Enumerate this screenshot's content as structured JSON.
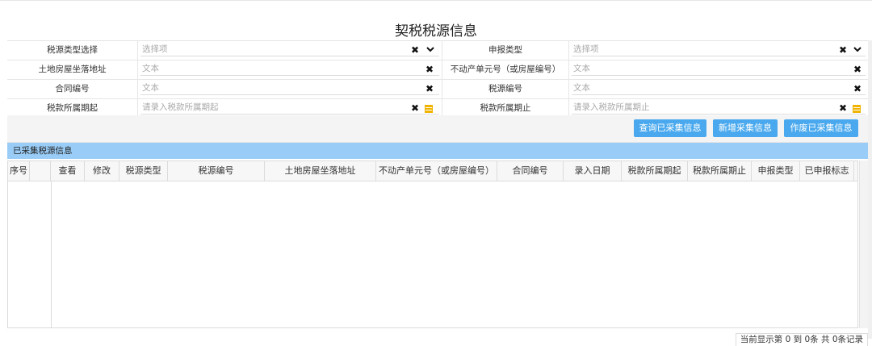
{
  "page": {
    "title": "契税税源信息"
  },
  "form": {
    "tax_type_label": "税源类型选择",
    "tax_type_placeholder": "选择项",
    "declare_type_label": "申报类型",
    "declare_type_placeholder": "选择项",
    "address_label": "土地房屋坐落地址",
    "address_placeholder": "文本",
    "property_unit_label": "不动产单元号（或房屋编号）",
    "property_unit_placeholder": "文本",
    "contract_no_label": "合同编号",
    "contract_no_placeholder": "文本",
    "tax_source_no_label": "税源编号",
    "tax_source_no_placeholder": "文本",
    "period_start_label": "税款所属期起",
    "period_start_placeholder": "请录入税款所属期起",
    "period_end_label": "税款所属期止",
    "period_end_placeholder": "请录入税款所属期止"
  },
  "buttons": {
    "query": "查询已采集信息",
    "add": "新增采集信息",
    "void": "作废已采集信息"
  },
  "panel": {
    "title": "已采集税源信息"
  },
  "table": {
    "columns": [
      "序号",
      "查看",
      "修改",
      "税源类型",
      "税源编号",
      "土地房屋坐落地址",
      "不动产单元号（或房屋编号）",
      "合同编号",
      "录入日期",
      "税款所属期起",
      "税款所属期止",
      "申报类型",
      "已申报标志"
    ]
  },
  "pager": {
    "text": "当前显示第  0 到  0条  共  0条记录"
  },
  "colors": {
    "accent": "#4aa9ee",
    "panel": "#99ccf6",
    "calendar": "#f0b400"
  }
}
